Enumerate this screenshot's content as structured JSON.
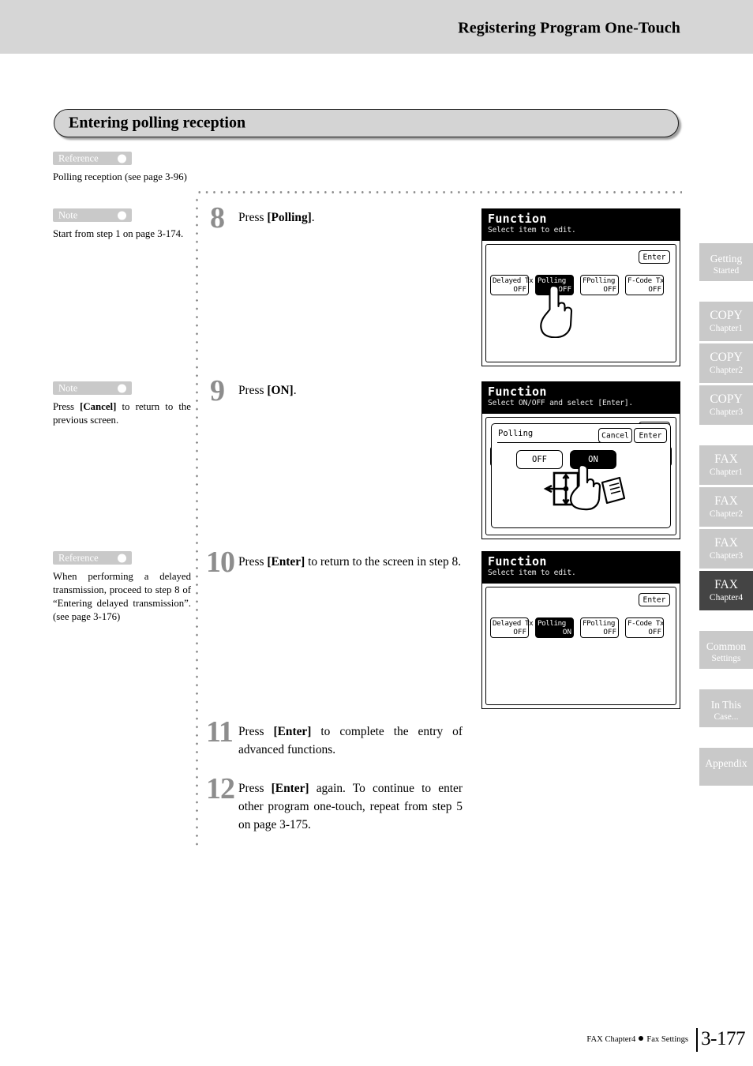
{
  "header": {
    "running_title": "Registering Program One-Touch"
  },
  "section": {
    "title": "Entering polling reception"
  },
  "side_notes": [
    {
      "tag": "Reference",
      "text": "Polling reception (see page 3-96)"
    },
    {
      "tag": "Note",
      "text": "Start from step 1 on page 3-174."
    },
    {
      "tag": "Note",
      "text_before": "Press ",
      "bold": "[Cancel]",
      "text_after": " to return to the previous screen."
    },
    {
      "tag": "Reference",
      "text": "When performing a delayed transmission, proceed to step 8 of “Entering delayed transmission”. (see page 3-176)"
    }
  ],
  "steps": [
    {
      "number": "8",
      "before": "Press ",
      "bold": "[Polling]",
      "after": "."
    },
    {
      "number": "9",
      "before": "Press ",
      "bold": "[ON]",
      "after": "."
    },
    {
      "number": "10",
      "before": "Press ",
      "bold": "[Enter]",
      "after": " to return to the screen in step 8."
    },
    {
      "number": "11",
      "before": "Press ",
      "bold": "[Enter]",
      "after": " to complete the entry of advanced functions."
    },
    {
      "number": "12",
      "before": "Press ",
      "bold": "[Enter]",
      "after": " again. To continue to enter other program one-touch, repeat from step 5 on page 3-175."
    }
  ],
  "lcd_panels": [
    {
      "id": "panel-step8",
      "title": "Function",
      "subtitle": "Select item to edit.",
      "enter_label": "Enter",
      "function_keys": [
        {
          "name": "Delayed Tx",
          "value": "OFF",
          "selected": false
        },
        {
          "name": "Polling",
          "value": "OFF",
          "selected": true
        },
        {
          "name": "FPolling",
          "value": "OFF",
          "selected": false
        },
        {
          "name": "F-Code Tx",
          "value": "OFF",
          "selected": false
        }
      ],
      "hand_icon": "pointing-hand-icon"
    },
    {
      "id": "panel-step9",
      "title": "Function",
      "subtitle": "Select ON/OFF and select [Enter].",
      "enter_label": "Enter",
      "dialog": {
        "title": "Polling",
        "cancel_label": "Cancel",
        "enter_label": "Enter",
        "options": [
          {
            "label": "OFF",
            "selected": false
          },
          {
            "label": "ON",
            "selected": true
          }
        ]
      },
      "hand_icon": "pointing-hand-polling-icon"
    },
    {
      "id": "panel-step10",
      "title": "Function",
      "subtitle": "Select item to edit.",
      "enter_label": "Enter",
      "function_keys": [
        {
          "name": "Delayed Tx",
          "value": "OFF",
          "selected": false
        },
        {
          "name": "Polling",
          "value": "ON",
          "selected": true
        },
        {
          "name": "FPolling",
          "value": "OFF",
          "selected": false
        },
        {
          "name": "F-Code Tx",
          "value": "OFF",
          "selected": false
        }
      ]
    }
  ],
  "chapter_tabs": [
    {
      "main": "Getting",
      "sub": "Started",
      "two_line": true,
      "active": false,
      "gap_after": 26
    },
    {
      "main": "COPY",
      "sub": "Chapter1",
      "two_line": false,
      "active": false,
      "gap_after": 3
    },
    {
      "main": "COPY",
      "sub": "Chapter2",
      "two_line": false,
      "active": false,
      "gap_after": 3
    },
    {
      "main": "COPY",
      "sub": "Chapter3",
      "two_line": false,
      "active": false,
      "gap_after": 26
    },
    {
      "main": "FAX",
      "sub": "Chapter1",
      "two_line": false,
      "active": false,
      "gap_after": 3
    },
    {
      "main": "FAX",
      "sub": "Chapter2",
      "two_line": false,
      "active": false,
      "gap_after": 3
    },
    {
      "main": "FAX",
      "sub": "Chapter3",
      "two_line": false,
      "active": false,
      "gap_after": 3
    },
    {
      "main": "FAX",
      "sub": "Chapter4",
      "two_line": false,
      "active": true,
      "gap_after": 26
    },
    {
      "main": "Common",
      "sub": "Settings",
      "two_line": true,
      "active": false,
      "gap_after": 26
    },
    {
      "main": "In This",
      "sub": "Case...",
      "two_line": true,
      "active": false,
      "gap_after": 26
    },
    {
      "main": "Appendix",
      "sub": "",
      "two_line": true,
      "active": false,
      "gap_after": 0
    }
  ],
  "footer": {
    "chapter": "FAX Chapter4",
    "section": "Fax Settings",
    "page_number": "3-177"
  },
  "colors": {
    "header_bg": "#d6d6d6",
    "banner_bg": "#d4d4d4",
    "tag_bg": "#c9c9c9",
    "tab_bg": "#c9c9c9",
    "tab_active_bg": "#444444",
    "step_number": "#8d8d8d"
  }
}
